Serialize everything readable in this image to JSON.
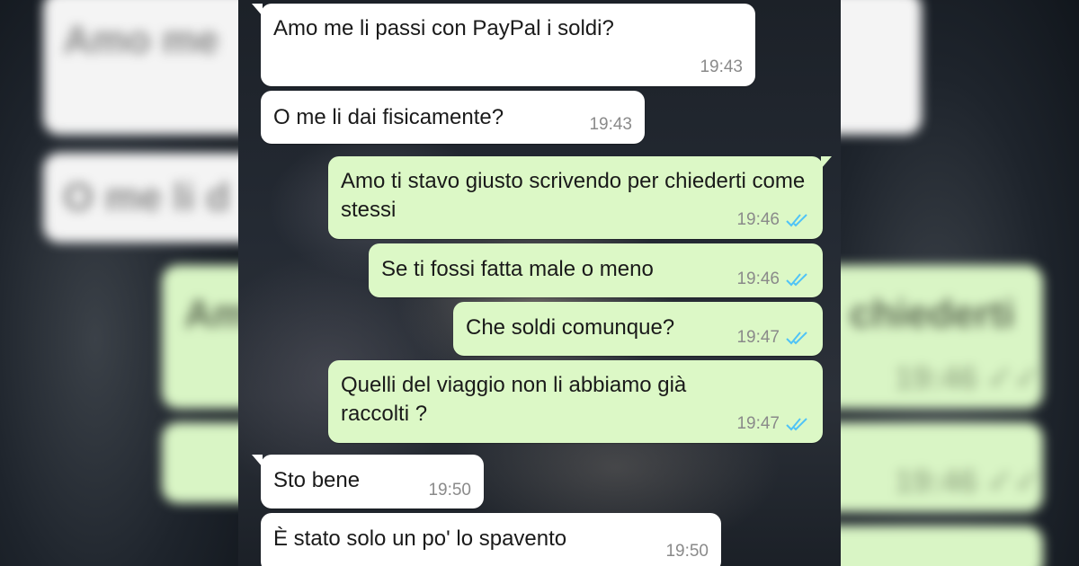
{
  "colors": {
    "incoming_bubble": "#ffffff",
    "outgoing_bubble": "#dcf8c6",
    "read_ticks": "#4fc3f7",
    "timestamp": "#8a8a8a"
  },
  "messages": [
    {
      "direction": "incoming",
      "text": "Amo me li passi con PayPal i soldi?",
      "time": "19:43",
      "status": ""
    },
    {
      "direction": "incoming",
      "text": "O me li dai fisicamente?",
      "time": "19:43",
      "status": ""
    },
    {
      "direction": "outgoing",
      "text": "Amo ti stavo giusto scrivendo per chiederti come stessi",
      "time": "19:46",
      "status": "read"
    },
    {
      "direction": "outgoing",
      "text": "Se ti fossi fatta male o meno",
      "time": "19:46",
      "status": "read"
    },
    {
      "direction": "outgoing",
      "text": "Che soldi comunque?",
      "time": "19:47",
      "status": "read"
    },
    {
      "direction": "outgoing",
      "text": "Quelli del viaggio non li abbiamo già raccolti ?",
      "time": "19:47",
      "status": "read"
    },
    {
      "direction": "incoming",
      "text": "Sto bene",
      "time": "19:50",
      "status": ""
    },
    {
      "direction": "incoming",
      "text": "È stato solo un po' lo spavento",
      "time": "19:50",
      "status": ""
    }
  ]
}
